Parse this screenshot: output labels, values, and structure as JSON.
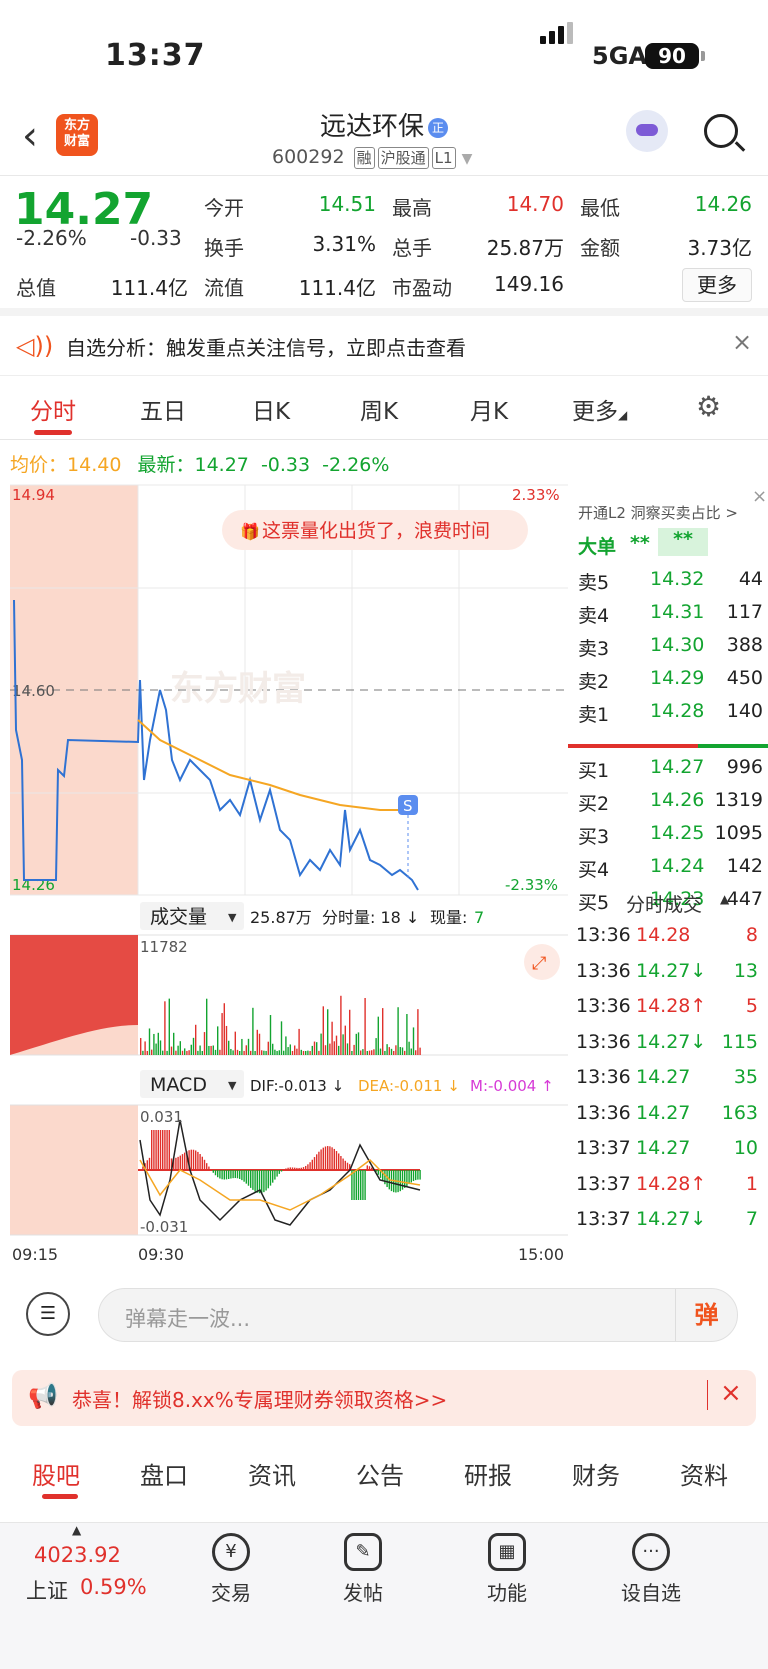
{
  "status": {
    "time": "13:37",
    "network": "5GA",
    "battery": "90"
  },
  "header": {
    "logo": "东方财富",
    "stock_name": "远达环保",
    "badge": "正",
    "code": "600292",
    "tags": [
      "融",
      "沪股通",
      "L1"
    ]
  },
  "quote": {
    "price": "14.27",
    "pct": "-2.26%",
    "chg": "-0.33",
    "fields": [
      {
        "label": "今开",
        "value": "14.51",
        "color": "green"
      },
      {
        "label": "最高",
        "value": "14.70",
        "color": "red"
      },
      {
        "label": "最低",
        "value": "14.26",
        "color": "green"
      },
      {
        "label": "换手",
        "value": "3.31%",
        "color": "dark"
      },
      {
        "label": "总手",
        "value": "25.87万",
        "color": "dark"
      },
      {
        "label": "金额",
        "value": "3.73亿",
        "color": "dark"
      },
      {
        "label": "总值",
        "value": "111.4亿",
        "color": "dark"
      },
      {
        "label": "流值",
        "value": "111.4亿",
        "color": "dark"
      },
      {
        "label": "市盈动",
        "value": "149.16",
        "color": "dark"
      }
    ],
    "more": "更多"
  },
  "info_bar": {
    "text": "自选分析：触发重点关注信号，立即点击查看"
  },
  "tabs": [
    "分时",
    "五日",
    "日K",
    "周K",
    "月K",
    "更多"
  ],
  "avg_line": {
    "avg_label": "均价：",
    "avg": "14.40",
    "latest_label": "最新：",
    "latest": "14.27",
    "chg": "-0.33",
    "pct": "-2.26%"
  },
  "chart": {
    "top_price": "14.94",
    "top_pct": "2.33%",
    "mid_price": "14.60",
    "bottom_price": "14.26",
    "bottom_pct": "-2.33%",
    "banner": "这票量化出货了，浪费时间",
    "watermark": "东方财富",
    "vol_label": "成交量",
    "vol_total": "25.87万",
    "fs_vol": "分时量: 18 ↓",
    "now_vol": "现量:",
    "now_vol_val": "7",
    "vol_max": "11782",
    "macd_label": "MACD",
    "dif": "DIF:-0.013 ↓",
    "dea": "DEA:-0.011 ↓",
    "m": "M:-0.004 ↑",
    "macd_top": "0.031",
    "macd_bot": "-0.031",
    "t1": "09:15",
    "t2": "09:30",
    "t3": "15:00",
    "signal": "S"
  },
  "chart_data": {
    "type": "line",
    "title": "",
    "series": [
      {
        "name": "价格",
        "values": [
          14.6,
          14.4,
          14.45,
          14.55,
          14.5,
          14.6,
          14.45,
          14.48,
          14.52,
          14.46,
          14.4,
          14.38,
          14.42,
          14.36,
          14.39,
          14.41,
          14.37,
          14.35,
          14.3,
          14.33,
          14.29,
          14.32,
          14.3,
          14.28,
          14.31,
          14.36,
          14.33,
          14.31,
          14.29,
          14.27
        ]
      },
      {
        "name": "均价",
        "values": [
          14.55,
          14.5,
          14.48,
          14.47,
          14.46,
          14.46,
          14.45,
          14.45,
          14.44,
          14.44,
          14.43,
          14.43,
          14.42,
          14.42,
          14.42,
          14.41,
          14.41,
          14.41,
          14.4,
          14.4,
          14.4,
          14.4,
          14.4,
          14.4,
          14.4,
          14.4,
          14.4,
          14.4,
          14.4,
          14.4
        ]
      }
    ],
    "ylim": [
      14.26,
      14.94
    ]
  },
  "orderbook": {
    "promo": "开通L2 洞察买卖占比 >",
    "big": "大单",
    "stars": "**",
    "asks": [
      {
        "label": "卖5",
        "price": "14.32",
        "vol": "44"
      },
      {
        "label": "卖4",
        "price": "14.31",
        "vol": "117"
      },
      {
        "label": "卖3",
        "price": "14.30",
        "vol": "388"
      },
      {
        "label": "卖2",
        "price": "14.29",
        "vol": "450"
      },
      {
        "label": "卖1",
        "price": "14.28",
        "vol": "140"
      }
    ],
    "bids": [
      {
        "label": "买1",
        "price": "14.27",
        "vol": "996"
      },
      {
        "label": "买2",
        "price": "14.26",
        "vol": "1319"
      },
      {
        "label": "买3",
        "price": "14.25",
        "vol": "1095"
      },
      {
        "label": "买4",
        "price": "14.24",
        "vol": "142"
      },
      {
        "label": "买5",
        "price": "14.23",
        "vol": "447"
      }
    ]
  },
  "ticks": {
    "title": "分时成交",
    "rows": [
      {
        "t": "13:36",
        "p": "14.28",
        "v": "8",
        "c": "red",
        "a": ""
      },
      {
        "t": "13:36",
        "p": "14.27↓",
        "v": "13",
        "c": "green",
        "a": ""
      },
      {
        "t": "13:36",
        "p": "14.28↑",
        "v": "5",
        "c": "red",
        "a": ""
      },
      {
        "t": "13:36",
        "p": "14.27↓",
        "v": "115",
        "c": "green",
        "a": ""
      },
      {
        "t": "13:36",
        "p": "14.27",
        "v": "35",
        "c": "green",
        "a": ""
      },
      {
        "t": "13:36",
        "p": "14.27",
        "v": "163",
        "c": "green",
        "a": ""
      },
      {
        "t": "13:37",
        "p": "14.27",
        "v": "10",
        "c": "green",
        "a": ""
      },
      {
        "t": "13:37",
        "p": "14.28↑",
        "v": "1",
        "c": "red",
        "a": ""
      },
      {
        "t": "13:37",
        "p": "14.27↓",
        "v": "7",
        "c": "green",
        "a": ""
      }
    ]
  },
  "comment": {
    "placeholder": "弹幕走一波...",
    "btn": "弹"
  },
  "promo": {
    "text": "恭喜！解锁8.xx%专属理财券领取资格>>"
  },
  "bottom_tabs": [
    "股吧",
    "盘口",
    "资讯",
    "公告",
    "研报",
    "财务",
    "资料"
  ],
  "bottom_nav": {
    "index_value": "4023.92",
    "index_name": "上证",
    "index_pct": "0.59%",
    "items": [
      "交易",
      "发帖",
      "功能",
      "设自选"
    ]
  }
}
